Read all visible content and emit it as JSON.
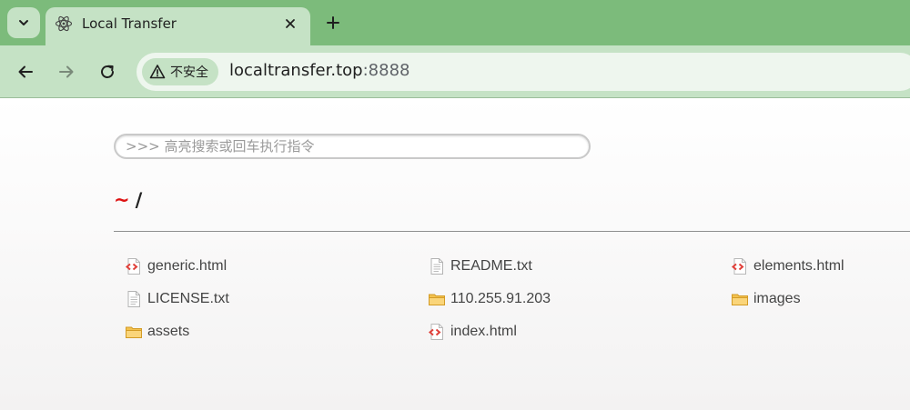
{
  "browser": {
    "tab": {
      "title": "Local Transfer",
      "icon": "atom-icon"
    },
    "address": {
      "security_label": "不安全",
      "host": "localtransfer.top",
      "port": ":8888"
    }
  },
  "page": {
    "search_placeholder": ">>> 高亮搜索或回车执行指令",
    "breadcrumb": {
      "home": "~",
      "separator": "/"
    },
    "files": [
      {
        "name": "generic.html",
        "type": "html-file",
        "icon": "html-file-icon"
      },
      {
        "name": "README.txt",
        "type": "text-file",
        "icon": "text-file-icon"
      },
      {
        "name": "elements.html",
        "type": "html-file",
        "icon": "html-file-icon"
      },
      {
        "name": "LICENSE.txt",
        "type": "text-file",
        "icon": "text-file-icon"
      },
      {
        "name": "110.255.91.203",
        "type": "folder",
        "icon": "folder-icon"
      },
      {
        "name": "images",
        "type": "folder",
        "icon": "folder-icon"
      },
      {
        "name": "assets",
        "type": "folder",
        "icon": "folder-icon"
      },
      {
        "name": "index.html",
        "type": "html-file",
        "icon": "html-file-icon"
      }
    ]
  },
  "colors": {
    "tabstrip": "#7cbb7b",
    "toolbar": "#c5e2c5",
    "breadcrumb_home": "#dd1111",
    "folder": "#f3c24f",
    "html_icon": "#e0403a"
  }
}
